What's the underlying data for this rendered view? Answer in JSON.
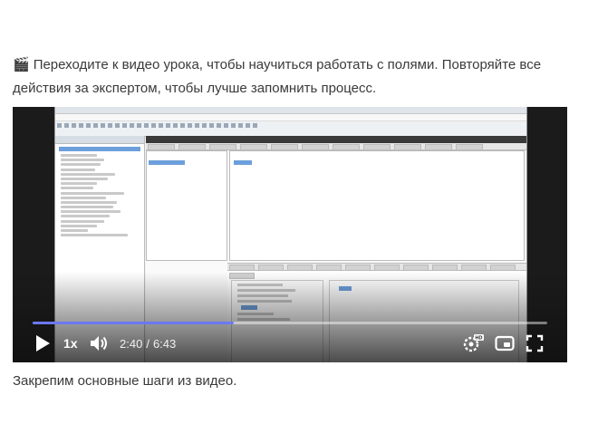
{
  "intro": {
    "icon": "clapper-board-icon",
    "text": "Переходите к видео урока, чтобы научиться работать с полями. Повторяйте все действия за экспертом, чтобы лучше запомнить процесс."
  },
  "player": {
    "progress_fraction": 0.39,
    "speed_label": "1x",
    "current_time": "2:40",
    "separator": "/",
    "duration": "6:43",
    "accent_color": "#6b78f2",
    "icons": [
      "play-icon",
      "volume-icon",
      "hd-settings-icon",
      "miniplayer-icon",
      "fullscreen-icon"
    ]
  },
  "footer": {
    "text": "Закрепим основные шаги из видео."
  }
}
